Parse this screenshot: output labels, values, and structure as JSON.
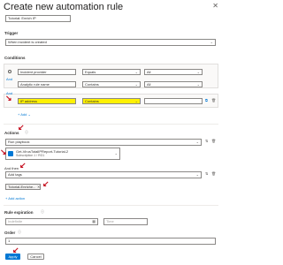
{
  "header": {
    "title": "Create new automation rule",
    "close_icon": "close-icon"
  },
  "rule_name": {
    "value": "Tutorial: Enrich IP"
  },
  "trigger": {
    "label": "Trigger",
    "value": "When incident is created"
  },
  "conditions": {
    "label": "Conditions",
    "rows": [
      {
        "field": "Incident provider",
        "operator": "Equals",
        "value": "All"
      },
      {
        "field": "Analytic rule name",
        "operator": "Contains",
        "value": "All"
      },
      {
        "field": "IP address",
        "operator": "Contains",
        "value": ""
      }
    ],
    "and_label": "And",
    "add_label": "Add"
  },
  "actions": {
    "label": "Actions",
    "action1_value": "Run playbook",
    "playbook_name": "Get-VirusTotalIPReport-Tutorial-2",
    "playbook_sub": "Subscription 1 / RG1",
    "and_then": "And then",
    "action2_value": "Add tags",
    "tag_value": "Tutorial-Enriche...",
    "add_action": "+ Add action"
  },
  "rule_expiration": {
    "label": "Rule expiration",
    "date_placeholder": "Indefinite",
    "time_placeholder": "Time"
  },
  "order": {
    "label": "Order",
    "value": "1"
  },
  "footer": {
    "apply": "Apply",
    "cancel": "Cancel"
  },
  "colors": {
    "accent": "#0078d4",
    "highlight": "#fff100",
    "arrow": "#c50f1f"
  }
}
